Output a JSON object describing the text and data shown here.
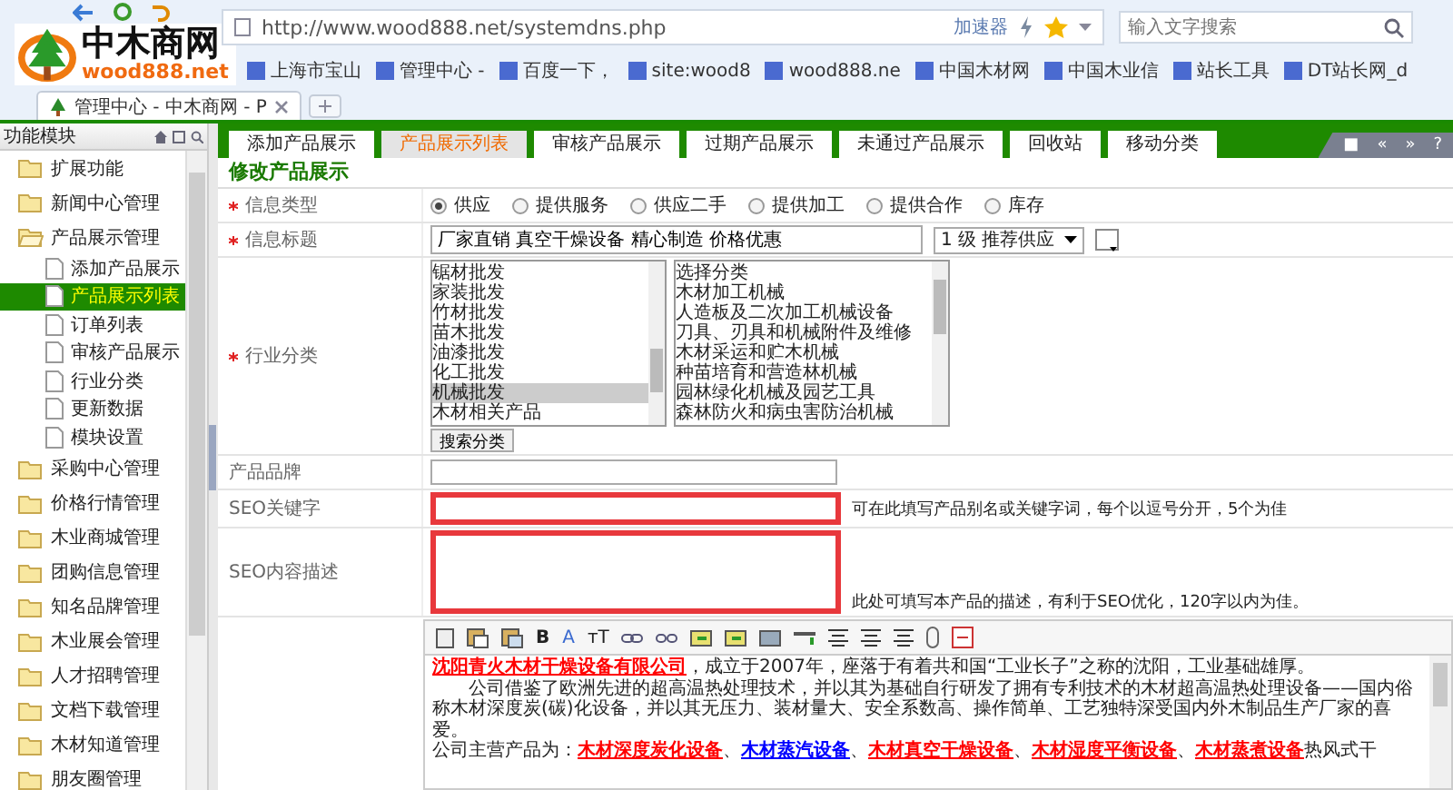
{
  "browser": {
    "url": "http://www.wood888.net/systemdns.php",
    "accelerator": "加速器",
    "search_placeholder": "输入文字搜索",
    "bookmarks": [
      "上海市宝山",
      "管理中心 -",
      "百度一下，",
      "site:wood8",
      "wood888.ne",
      "中国木材网",
      "中国木业信",
      "站长工具",
      "DT站长网_d"
    ],
    "tab_title": "管理中心 - 中木商网 - P"
  },
  "logo": {
    "name": "中木商网",
    "domain": "wood888.net"
  },
  "sidebar": {
    "title": "功能模块",
    "items": [
      {
        "label": "扩展功能",
        "expanded": false
      },
      {
        "label": "新闻中心管理",
        "expanded": false
      },
      {
        "label": "产品展示管理",
        "expanded": true,
        "children": [
          {
            "label": "添加产品展示",
            "selected": false
          },
          {
            "label": "产品展示列表",
            "selected": true
          },
          {
            "label": "订单列表",
            "selected": false
          },
          {
            "label": "审核产品展示",
            "selected": false
          },
          {
            "label": "行业分类",
            "selected": false
          },
          {
            "label": "更新数据",
            "selected": false
          },
          {
            "label": "模块设置",
            "selected": false
          }
        ]
      },
      {
        "label": "采购中心管理",
        "expanded": false
      },
      {
        "label": "价格行情管理",
        "expanded": false
      },
      {
        "label": "木业商城管理",
        "expanded": false
      },
      {
        "label": "团购信息管理",
        "expanded": false
      },
      {
        "label": "知名品牌管理",
        "expanded": false
      },
      {
        "label": "木业展会管理",
        "expanded": false
      },
      {
        "label": "人才招聘管理",
        "expanded": false
      },
      {
        "label": "文档下载管理",
        "expanded": false
      },
      {
        "label": "木材知道管理",
        "expanded": false
      },
      {
        "label": "朋友圈管理",
        "expanded": false
      }
    ]
  },
  "tabs": [
    {
      "label": "添加产品展示",
      "selected": false
    },
    {
      "label": "产品展示列表",
      "selected": true
    },
    {
      "label": "审核产品展示",
      "selected": false
    },
    {
      "label": "过期产品展示",
      "selected": false
    },
    {
      "label": "未通过产品展示",
      "selected": false
    },
    {
      "label": "回收站",
      "selected": false
    },
    {
      "label": "移动分类",
      "selected": false
    }
  ],
  "tab_tools": [
    "■",
    "«",
    "»",
    "?"
  ],
  "section_title": "修改产品展示",
  "form": [
    {
      "kind": "radios",
      "label": "信息类型",
      "required": true,
      "options": [
        {
          "label": "供应",
          "selected": true
        },
        {
          "label": "提供服务",
          "selected": false
        },
        {
          "label": "供应二手",
          "selected": false
        },
        {
          "label": "提供加工",
          "selected": false
        },
        {
          "label": "提供合作",
          "selected": false
        },
        {
          "label": "库存",
          "selected": false
        }
      ]
    },
    {
      "kind": "title",
      "label": "信息标题",
      "required": true,
      "value": "厂家直销 真空干燥设备 精心制造 价格优惠",
      "level_select": "1 级 推荐供应"
    },
    {
      "kind": "category",
      "label": "行业分类",
      "required": true,
      "lists": [
        {
          "options": [
            {
              "label": "锯材批发",
              "selected": false
            },
            {
              "label": "家装批发",
              "selected": false
            },
            {
              "label": "竹材批发",
              "selected": false
            },
            {
              "label": "苗木批发",
              "selected": false
            },
            {
              "label": "油漆批发",
              "selected": false
            },
            {
              "label": "化工批发",
              "selected": false
            },
            {
              "label": "机械批发",
              "selected": true
            },
            {
              "label": "木材相关产品",
              "selected": false
            }
          ]
        },
        {
          "options": [
            {
              "label": "选择分类",
              "selected": false
            },
            {
              "label": "木材加工机械",
              "selected": false
            },
            {
              "label": "人造板及二次加工机械设备",
              "selected": false
            },
            {
              "label": "刀具、刃具和机械附件及维修",
              "selected": false
            },
            {
              "label": "木材采运和贮木机械",
              "selected": false
            },
            {
              "label": "种苗培育和营造林机械",
              "selected": false
            },
            {
              "label": "园林绿化机械及园艺工具",
              "selected": false
            },
            {
              "label": "森林防火和病虫害防治机械",
              "selected": false
            }
          ]
        }
      ],
      "button": "搜索分类"
    },
    {
      "kind": "input",
      "label": "产品品牌",
      "required": false,
      "highlighted": false
    },
    {
      "kind": "input",
      "label": "SEO关键字",
      "required": false,
      "highlighted": true,
      "hint": "可在此填写产品别名或关键字词，每个以逗号分开，5个为佳"
    },
    {
      "kind": "textarea",
      "label": "SEO内容描述",
      "required": false,
      "highlighted": true,
      "hint": "此处可填写本产品的描述，有利于SEO优化，120字以内为佳。"
    }
  ],
  "editor": {
    "toolbar_labels": [
      "B",
      "A",
      "тT"
    ],
    "paragraphs": [
      {
        "indent": false,
        "parts": [
          {
            "kind": "link",
            "text": "沈阳青火木材干燥设备有限公司",
            "color": "#ff0000"
          },
          {
            "kind": "text",
            "text": "，成立于2007年，座落于有着共和国“工业长子”之称的沈阳，工业基础雄厚。"
          }
        ]
      },
      {
        "indent": true,
        "parts": [
          {
            "kind": "text",
            "text": "公司借鉴了欧洲先进的超高温热处理技术，并以其为基础自行研发了拥有专利技术的木材超高温热处理设备——国内俗称木材深度炭(碳)化设备，并以其无压力、装材量大、安全系数高、操作简单、工艺独特深受国内外木制品生产厂家的喜爱。"
          }
        ]
      },
      {
        "indent": false,
        "parts": [
          {
            "kind": "text",
            "text": "公司主营产品为："
          },
          {
            "kind": "link",
            "text": "木材深度炭化设备",
            "color": "#ff0000"
          },
          {
            "kind": "text",
            "text": "、"
          },
          {
            "kind": "link",
            "text": "木材蒸汽设备",
            "color": "#0000ff"
          },
          {
            "kind": "text",
            "text": "、"
          },
          {
            "kind": "link",
            "text": "木材真空干燥设备",
            "color": "#ff0000"
          },
          {
            "kind": "text",
            "text": "、"
          },
          {
            "kind": "link",
            "text": "木材湿度平衡设备",
            "color": "#ff0000"
          },
          {
            "kind": "text",
            "text": "、"
          },
          {
            "kind": "link",
            "text": "木材蒸煮设备",
            "color": "#ff0000"
          },
          {
            "kind": "text",
            "text": "热风式干"
          }
        ]
      }
    ]
  }
}
